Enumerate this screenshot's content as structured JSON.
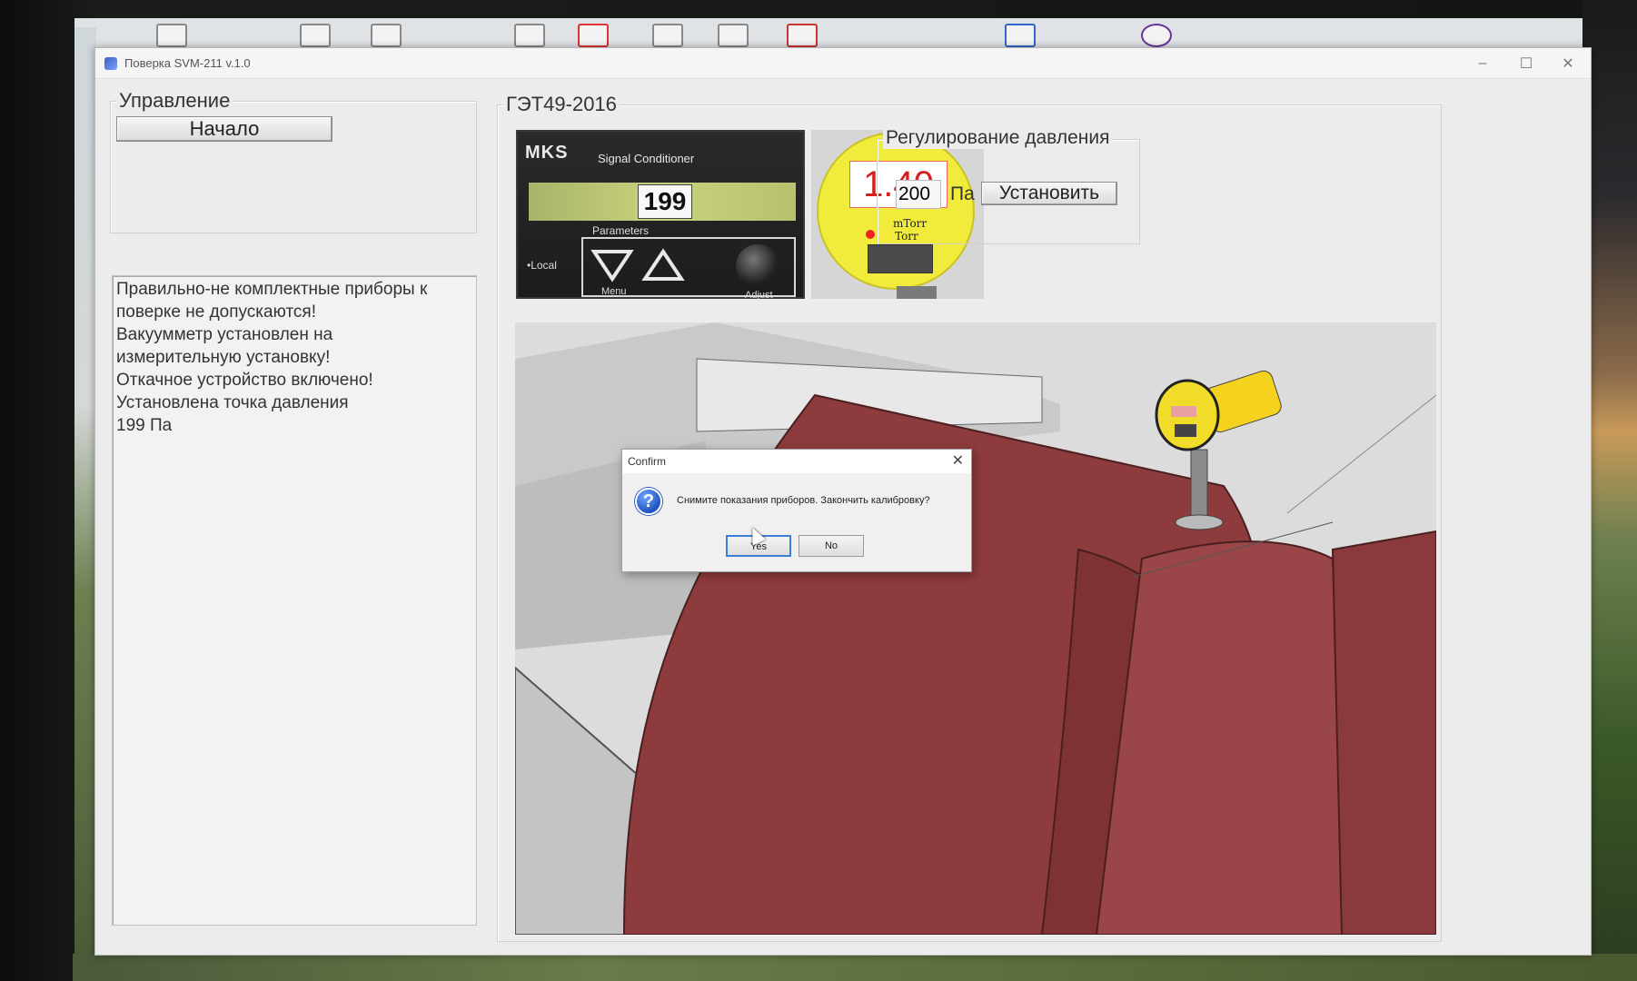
{
  "window": {
    "title": "Поверка SVM-211 v.1.0",
    "controls": {
      "minimize": "–",
      "maximize": "☐",
      "close": "✕"
    }
  },
  "control_group": {
    "title": "Управление",
    "start_button": "Начало"
  },
  "log": {
    "lines": [
      "Правильно-не комплектные приборы к",
      "поверке не допускаются!",
      "Вакуумметр установлен на",
      "измерительную установку!",
      "Откачное устройство включено!",
      "Установлена точка давления",
      "199 Па"
    ]
  },
  "standard_group": {
    "title": "ГЭТ49-2016",
    "mks": {
      "logo": "MKS",
      "device_name": "Signal Conditioner",
      "reading": "199",
      "parameters_label": "Parameters",
      "local_label": "•Local",
      "menu_label": "Menu",
      "adjust_label": "Adjust"
    },
    "gauge": {
      "reading": "1.40",
      "unit_1": "mTorr",
      "unit_2": "Torr"
    }
  },
  "pressure_group": {
    "title": "Регулирование давления",
    "value": "200",
    "unit": "Па",
    "set_button": "Установить"
  },
  "dialog": {
    "title": "Confirm",
    "close": "✕",
    "icon": "?",
    "message": "Снимите показания приборов. Закончить калибровку?",
    "yes": "Yes",
    "no": "No"
  },
  "colors": {
    "tank": "#8e3b3d",
    "tank_shadow": "#6f2b2e",
    "sensor_yellow": "#f4d21e",
    "gauge_yellow": "#f1ec3c",
    "gauge_text": "#d62020"
  }
}
